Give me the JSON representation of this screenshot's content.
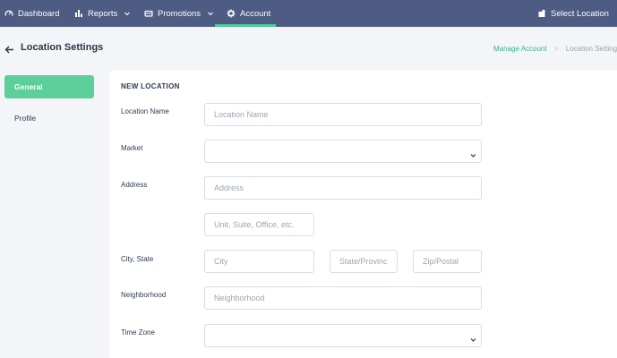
{
  "nav": {
    "dashboard": "Dashboard",
    "reports": "Reports",
    "promotions": "Promotions",
    "account": "Account",
    "select_location": "Select Location",
    "accent_color": "#4ccc96",
    "bg_color": "#4e5b82"
  },
  "header": {
    "title": "Location Settings",
    "breadcrumb": {
      "link": "Manage Account",
      "separator": ">",
      "current": "Location Settings"
    }
  },
  "sidebar": {
    "items": [
      {
        "label": "General",
        "active": true
      },
      {
        "label": "Profile",
        "active": false
      }
    ]
  },
  "form": {
    "section_title": "NEW LOCATION",
    "location_name": {
      "label": "Location Name",
      "placeholder": "Location Name"
    },
    "market": {
      "label": "Market",
      "value": ""
    },
    "address": {
      "label": "Address",
      "placeholder": "Address",
      "placeholder2": "Unit, Suite, Office, etc."
    },
    "city_state": {
      "label": "City, State",
      "city_placeholder": "City",
      "state_placeholder": "State/Province",
      "zip_placeholder": "Zip/Postal"
    },
    "neighborhood": {
      "label": "Neighborhood",
      "placeholder": "Neighborhood"
    },
    "time_zone": {
      "label": "Time Zone",
      "value": ""
    }
  },
  "icons": {
    "dashboard": "gauge-icon",
    "reports": "bar-chart-icon",
    "promotions": "ticket-icon",
    "account": "gear-icon",
    "location": "building-icon",
    "back": "arrow-left-icon",
    "dropdown": "chevron-down-icon"
  }
}
